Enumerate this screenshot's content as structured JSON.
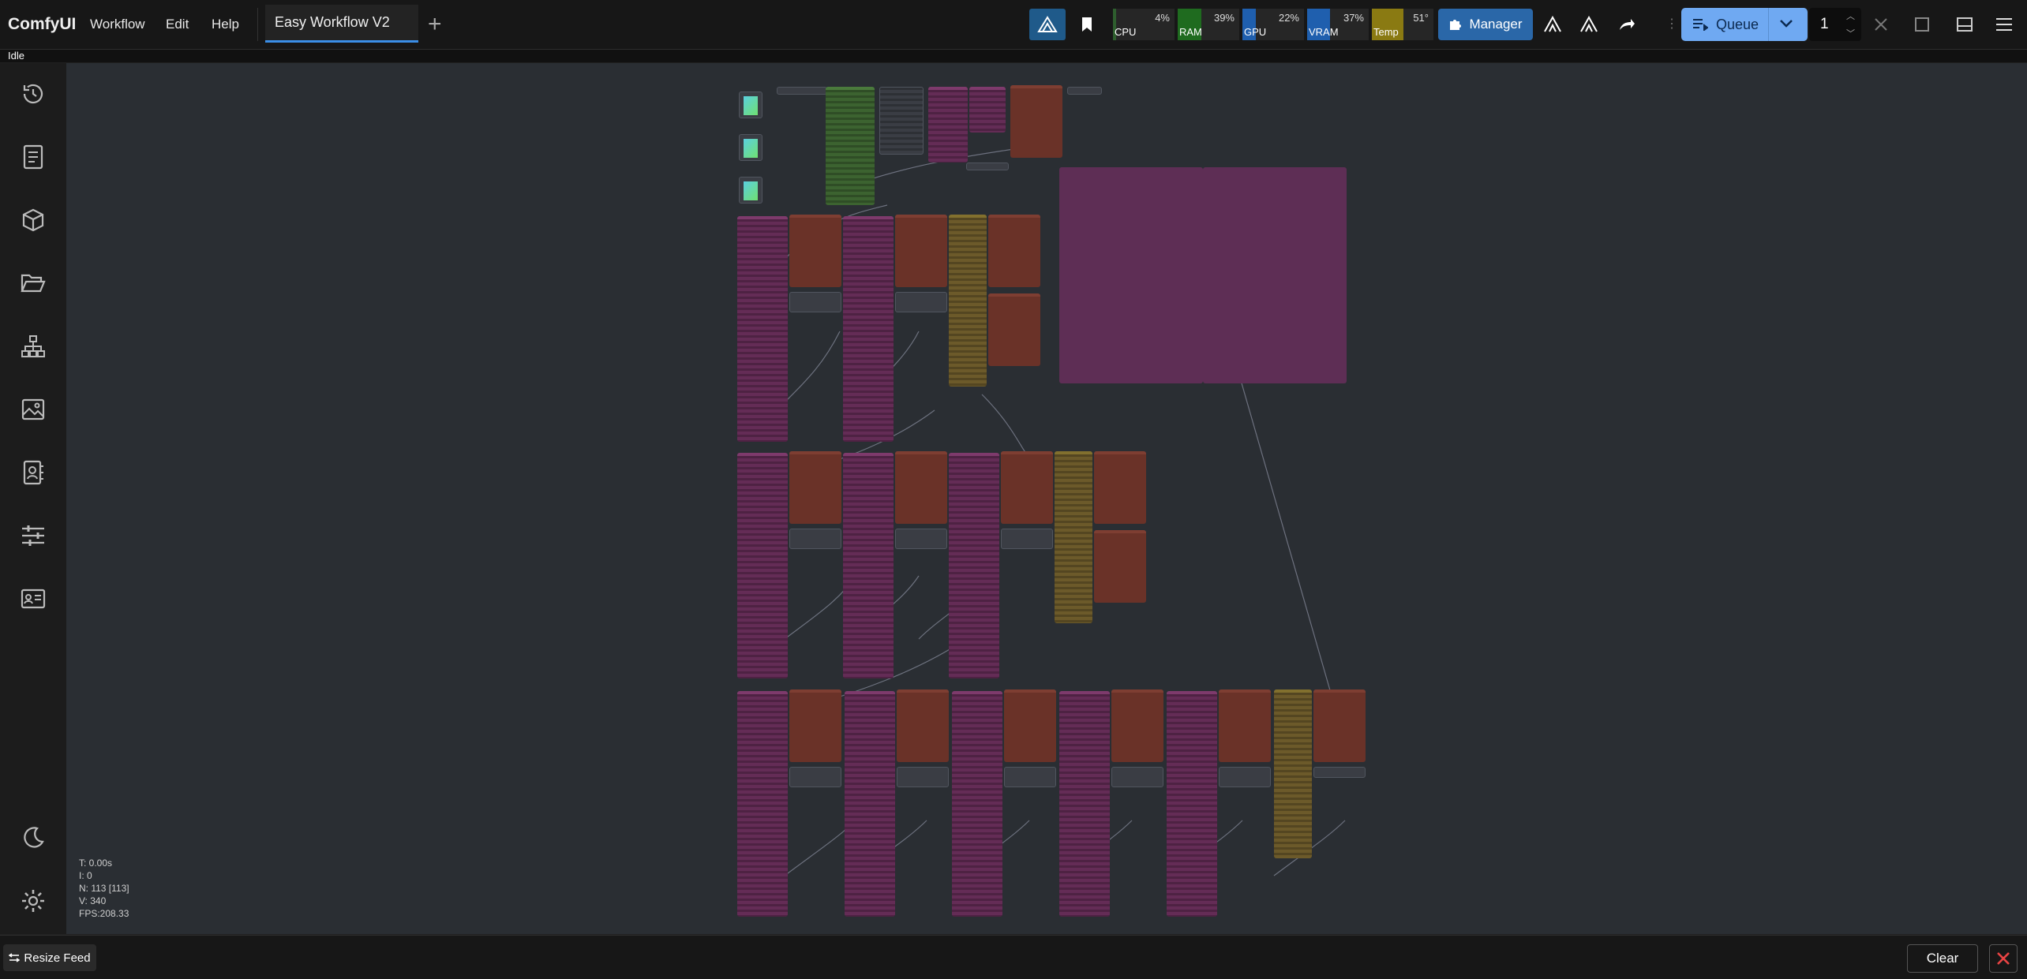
{
  "app": {
    "name": "ComfyUI"
  },
  "menu": {
    "workflow": "Workflow",
    "edit": "Edit",
    "help": "Help"
  },
  "tabs": [
    {
      "label": "Easy Workflow V2"
    }
  ],
  "tab_add": "+",
  "monitors": [
    {
      "label": "CPU",
      "value": "4%",
      "color": "#2e5e2e"
    },
    {
      "label": "RAM",
      "value": "39%",
      "color": "#1f6b1f"
    },
    {
      "label": "GPU",
      "value": "22%",
      "color": "#1f5fae"
    },
    {
      "label": "VRAM",
      "value": "37%",
      "color": "#1f5fae"
    },
    {
      "label": "Temp",
      "value": "51°",
      "color": "#8a7a12"
    }
  ],
  "manager": {
    "label": "Manager"
  },
  "queue": {
    "label": "Queue",
    "count": "1"
  },
  "status": {
    "text": "Idle"
  },
  "stats": {
    "t": "T: 0.00s",
    "i": "I: 0",
    "n": "N: 113 [113]",
    "v": "V: 340",
    "fps": "FPS:208.33"
  },
  "bottom": {
    "resize_label": "Resize Feed",
    "clear_label": "Clear"
  },
  "colors": {
    "accent": "#3b8ee6",
    "queue": "#6fa9f2",
    "manager": "#2a67a8",
    "danger": "#e84444"
  }
}
